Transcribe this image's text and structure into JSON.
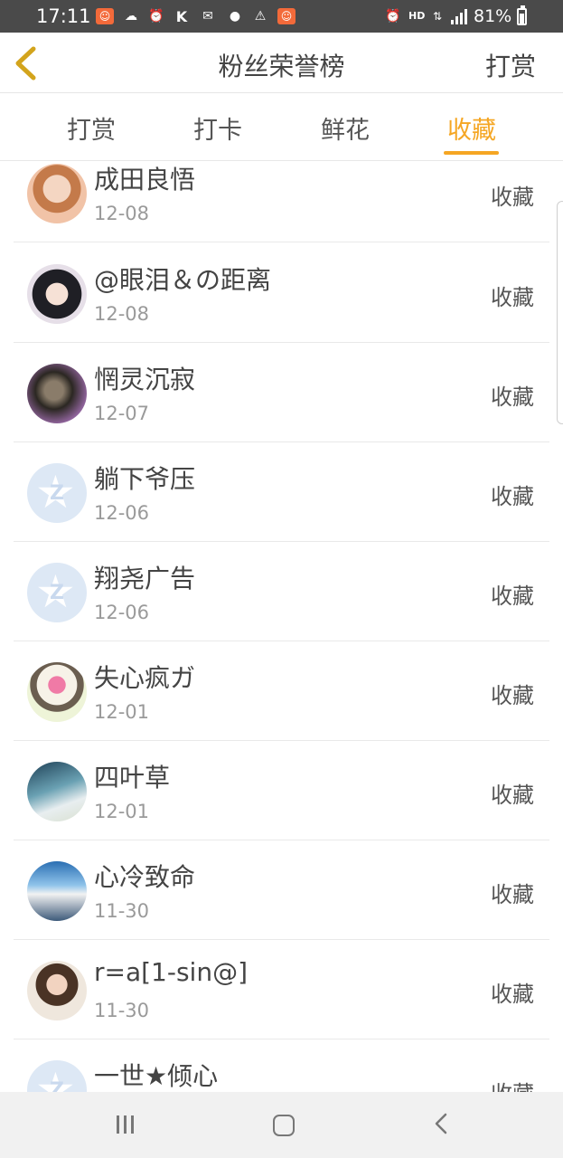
{
  "status_bar": {
    "time": "17:11",
    "battery_level": "81%",
    "hd_label": "HD",
    "left_icons": [
      "app-badge-icon",
      "weather-icon",
      "alarm-icon",
      "k-app-icon",
      "mail-icon",
      "chick-app-icon",
      "warning-icon",
      "app-badge-icon"
    ],
    "right_icons": [
      "alarm-icon",
      "hd-icon",
      "data-arrows-icon",
      "signal-icon",
      "battery-icon"
    ]
  },
  "header": {
    "title": "粉丝荣誉榜",
    "right_action": "打赏",
    "back_icon": "chevron-left-icon"
  },
  "tabs": [
    {
      "label": "打赏",
      "active": false
    },
    {
      "label": "打卡",
      "active": false
    },
    {
      "label": "鲜花",
      "active": false
    },
    {
      "label": "收藏",
      "active": true
    }
  ],
  "fans": [
    {
      "name": "成田良悟",
      "date": "12-08",
      "action": "收藏"
    },
    {
      "name": "@眼泪＆の距离",
      "date": "12-08",
      "action": "收藏"
    },
    {
      "name": "惘灵沉寂",
      "date": "12-07",
      "action": "收藏"
    },
    {
      "name": "躺下爷压",
      "date": "12-06",
      "action": "收藏"
    },
    {
      "name": "翔尧广告",
      "date": "12-06",
      "action": "收藏"
    },
    {
      "name": "失心疯ガ",
      "date": "12-01",
      "action": "收藏"
    },
    {
      "name": "四叶草",
      "date": "12-01",
      "action": "收藏"
    },
    {
      "name": "心冷致命",
      "date": "11-30",
      "action": "收藏"
    },
    {
      "name": "r=a[1-sin@]",
      "date": "11-30",
      "action": "收藏"
    },
    {
      "name": "一世★倾心",
      "date": "",
      "action": "收藏"
    }
  ],
  "colors": {
    "accent": "#f5a623",
    "status_bar": "#4a4a4a",
    "text_primary": "#444444",
    "text_secondary": "#9a9a9a",
    "nav_bar": "#f1f1f1"
  },
  "nav": {
    "icons": [
      "recent-apps-icon",
      "home-icon",
      "back-icon"
    ]
  }
}
